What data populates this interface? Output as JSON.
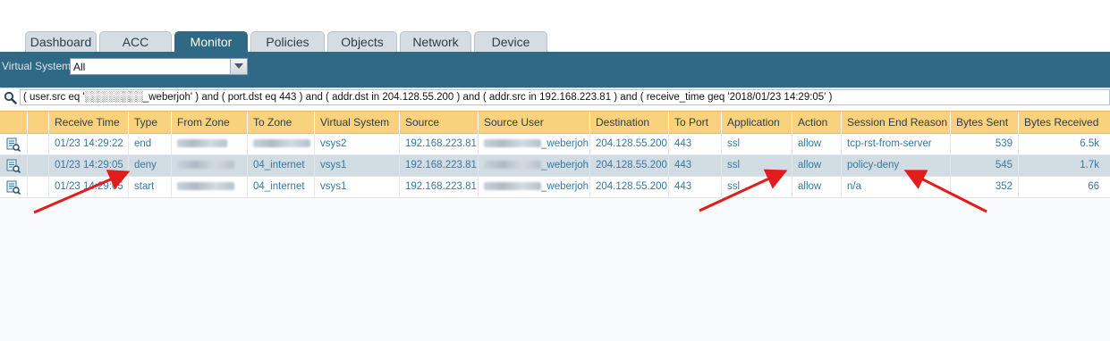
{
  "tabs": [
    "Dashboard",
    "ACC",
    "Monitor",
    "Policies",
    "Objects",
    "Network",
    "Device"
  ],
  "vsys": {
    "label": "Virtual System",
    "value": "All"
  },
  "filter": {
    "query": "( user.src eq '░░░░░░░░_weberjoh' ) and ( port.dst eq 443 ) and ( addr.dst in 204.128.55.200 ) and ( addr.src in 192.168.223.81 ) and ( receive_time geq '2018/01/23 14:29:05' )"
  },
  "columns": [
    "Receive Time",
    "Type",
    "From Zone",
    "To Zone",
    "Virtual System",
    "Source",
    "Source User",
    "Destination",
    "To Port",
    "Application",
    "Action",
    "Session End Reason",
    "Bytes Sent",
    "Bytes Received"
  ],
  "rows": [
    {
      "receive_time": "01/23 14:29:22",
      "type": "end",
      "from_zone": "",
      "to_zone": "",
      "vsys": "vsys2",
      "source": "192.168.223.81",
      "source_user": "_weberjoh",
      "destination": "204.128.55.200",
      "to_port": "443",
      "application": "ssl",
      "action": "allow",
      "session_end_reason": "tcp-rst-from-server",
      "bytes_sent": "539",
      "bytes_received": "6.5k"
    },
    {
      "receive_time": "01/23 14:29:05",
      "type": "deny",
      "from_zone": "",
      "to_zone": "04_internet",
      "vsys": "vsys1",
      "source": "192.168.223.81",
      "source_user": "_weberjoh",
      "destination": "204.128.55.200",
      "to_port": "443",
      "application": "ssl",
      "action": "allow",
      "session_end_reason": "policy-deny",
      "bytes_sent": "545",
      "bytes_received": "1.7k"
    },
    {
      "receive_time": "01/23 14:29:05",
      "type": "start",
      "from_zone": "",
      "to_zone": "04_internet",
      "vsys": "vsys1",
      "source": "192.168.223.81",
      "source_user": "_weberjoh",
      "destination": "204.128.55.200",
      "to_port": "443",
      "application": "ssl",
      "action": "allow",
      "session_end_reason": "n/a",
      "bytes_sent": "352",
      "bytes_received": "66"
    }
  ],
  "icons": {
    "filter": "search-icon",
    "row": "log-detail-icon",
    "dropdown": "chevron-down-icon"
  },
  "colors": {
    "tab_active": "#2f6985",
    "header": "#f8d27d",
    "link": "#3678a0",
    "arrow": "#e21c1c"
  }
}
